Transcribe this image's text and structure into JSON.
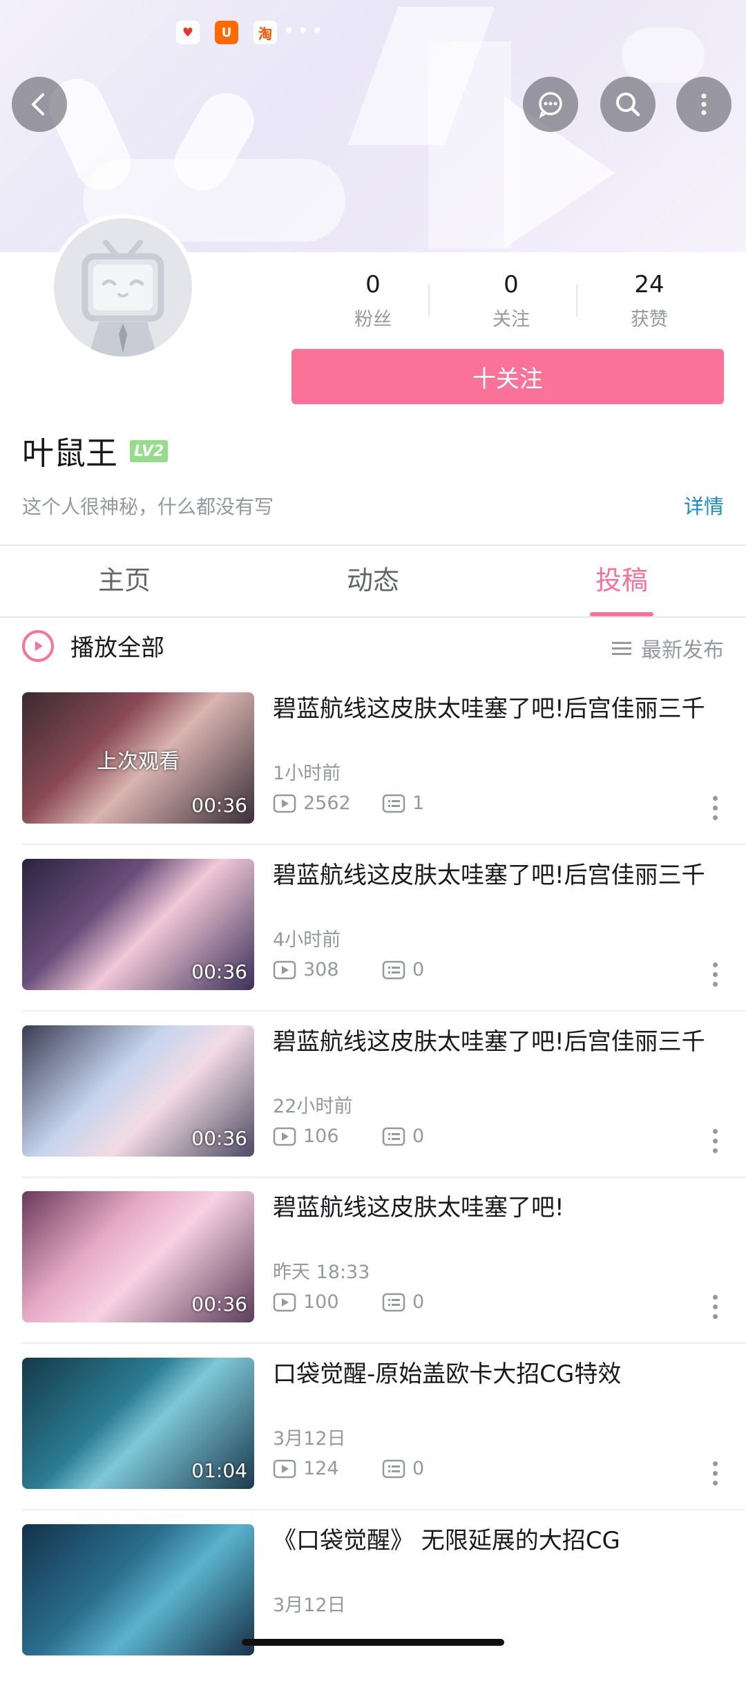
{
  "status_icons": [
    {
      "name": "app-notification-icon",
      "glyph": "♥",
      "color": "#e8362b"
    },
    {
      "name": "shop-notification-icon",
      "glyph": "U",
      "color": "#ff6a00"
    },
    {
      "name": "taobao-notification-icon",
      "glyph": "淘",
      "color": "#ff5000"
    }
  ],
  "header": {
    "back_icon": "chevron-left-icon",
    "message_icon": "message-icon",
    "search_icon": "search-icon",
    "more_icon": "more-vertical-icon"
  },
  "stats": [
    {
      "value": "0",
      "label": "粉丝"
    },
    {
      "value": "0",
      "label": "关注"
    },
    {
      "value": "24",
      "label": "获赞"
    }
  ],
  "follow_label": "十关注",
  "profile": {
    "name": "叶鼠王",
    "level": "LV2",
    "bio": "这个人很神秘，什么都没有写",
    "detail_link": "详情"
  },
  "tabs": [
    {
      "label": "主页"
    },
    {
      "label": "动态"
    },
    {
      "label": "投稿"
    }
  ],
  "active_tab": "投稿",
  "play_all_label": "播放全部",
  "sort_label": "最新发布",
  "videos": [
    {
      "title": "碧蓝航线这皮肤太哇塞了吧!后宫佳丽三千",
      "time": "1小时前",
      "views": "2562",
      "comments": "1",
      "duration": "00:36",
      "overlay": "上次观看"
    },
    {
      "title": "碧蓝航线这皮肤太哇塞了吧!后宫佳丽三千",
      "time": "4小时前",
      "views": "308",
      "comments": "0",
      "duration": "00:36"
    },
    {
      "title": "碧蓝航线这皮肤太哇塞了吧!后宫佳丽三千",
      "time": "22小时前",
      "views": "106",
      "comments": "0",
      "duration": "00:36"
    },
    {
      "title": "碧蓝航线这皮肤太哇塞了吧!",
      "time": "昨天 18:33",
      "views": "100",
      "comments": "0",
      "duration": "00:36"
    },
    {
      "title": "口袋觉醒-原始盖欧卡大招CG特效",
      "time": "3月12日",
      "views": "124",
      "comments": "0",
      "duration": "01:04"
    },
    {
      "title": "《口袋觉醒》 无限延展的大招CG",
      "time": "3月12日",
      "views": "",
      "comments": "",
      "duration": ""
    }
  ],
  "colors": {
    "accent": "#fb7299",
    "link": "#178bcf",
    "level_badge": "#95dd8a",
    "muted": "#9499a0"
  }
}
